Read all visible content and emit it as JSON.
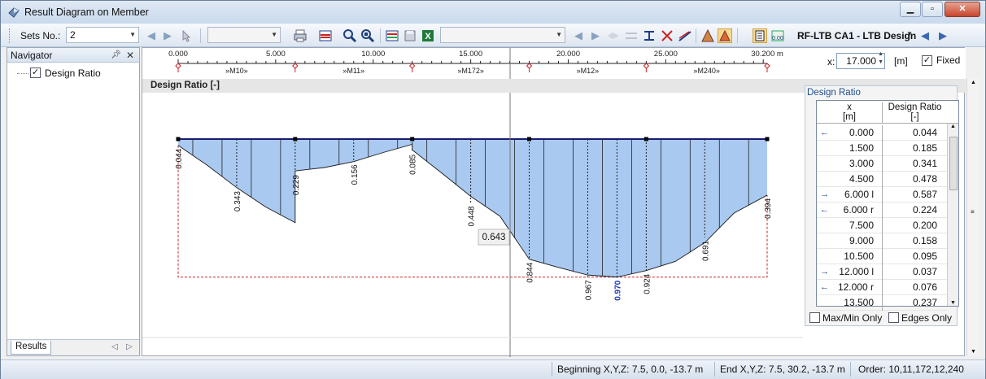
{
  "window": {
    "title": "Result Diagram on Member"
  },
  "toolbar": {
    "sets_label": "Sets No.:",
    "sets_value": "2",
    "module_value": "RF-LTB CA1 - LTB Design"
  },
  "navigator": {
    "title": "Navigator",
    "item_label": "Design Ratio",
    "item_checked": true,
    "tab_label": "Results"
  },
  "ruler": {
    "ticks": [
      "0.000",
      "5.000",
      "10.000",
      "15.000",
      "20.000",
      "25.000",
      "30.200 m"
    ],
    "members": [
      "»M10»",
      "»M11»",
      "»M172»",
      "»M12»",
      "»M240»"
    ]
  },
  "position": {
    "label": "x:",
    "value": "17.000",
    "unit": "[m]",
    "fixed_label": "Fixed",
    "fixed_checked": true
  },
  "section_title": "Design Ratio [-]",
  "diagram": {
    "cursor_value": "0.643",
    "labels": [
      "0.044",
      "0.343",
      "0.229",
      "0.156",
      "0.085",
      "0.448",
      "0.844",
      "0.967",
      "0.970",
      "0.924",
      "0.691",
      "0.394"
    ]
  },
  "table": {
    "title": "Design Ratio",
    "col1_header": "x",
    "col1_unit": "[m]",
    "col2_header": "Design Ratio",
    "col2_unit": "[-]",
    "rows": [
      {
        "marker": "left",
        "x": "0.000",
        "v": "0.044"
      },
      {
        "marker": "",
        "x": "1.500",
        "v": "0.185"
      },
      {
        "marker": "",
        "x": "3.000",
        "v": "0.341"
      },
      {
        "marker": "",
        "x": "4.500",
        "v": "0.478"
      },
      {
        "marker": "right",
        "x": "6.000 l",
        "v": "0.587"
      },
      {
        "marker": "left",
        "x": "6.000 r",
        "v": "0.224"
      },
      {
        "marker": "",
        "x": "7.500",
        "v": "0.200"
      },
      {
        "marker": "",
        "x": "9.000",
        "v": "0.158"
      },
      {
        "marker": "",
        "x": "10.500",
        "v": "0.095"
      },
      {
        "marker": "right",
        "x": "12.000 l",
        "v": "0.037"
      },
      {
        "marker": "left",
        "x": "12.000 r",
        "v": "0.076"
      },
      {
        "marker": "",
        "x": "13.500",
        "v": "0.237"
      }
    ],
    "opt_maxmin": "Max/Min Only",
    "opt_edges": "Edges Only"
  },
  "status": {
    "beginning": "Beginning X,Y,Z:   7.5, 0.0, -13.7 m",
    "end": "End X,Y,Z:   7.5, 30.2, -13.7 m",
    "order": "Order:   10,11,172,12,240"
  },
  "colors": {
    "fill": "#a9c9f0",
    "line": "#1a1a6e",
    "dashed": "#c0282a",
    "max": "#1d35b8"
  }
}
